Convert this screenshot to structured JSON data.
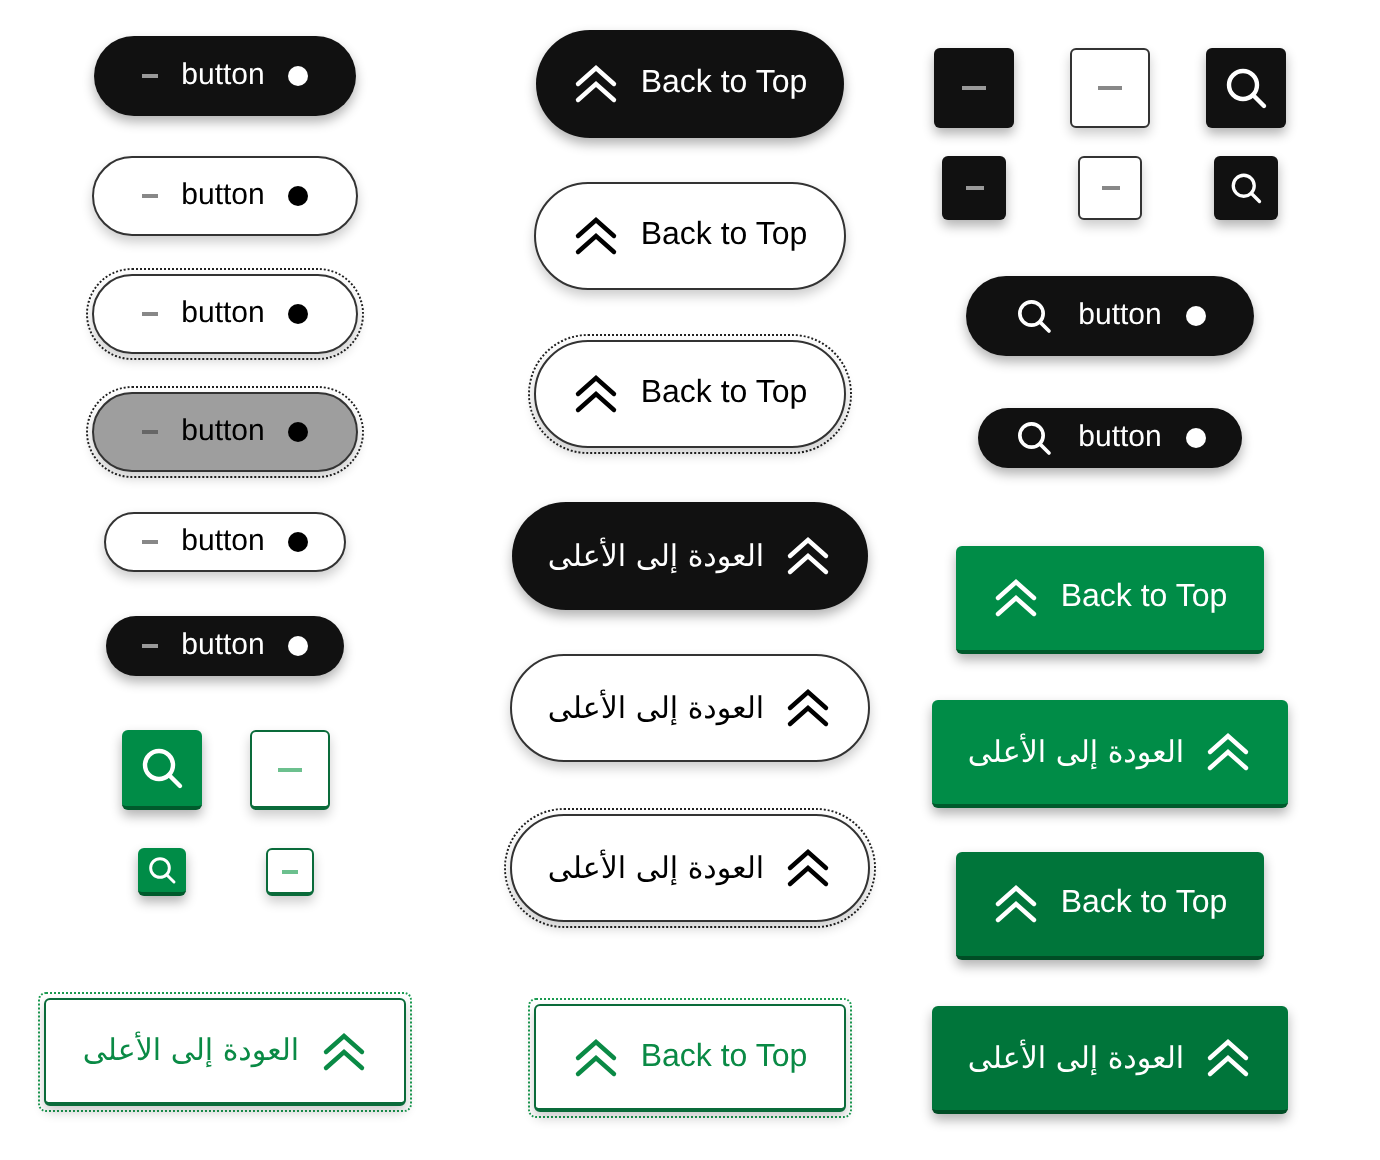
{
  "columns": [
    {
      "buttons": [
        {
          "label": "button",
          "focused": false
        },
        {
          "label": "button",
          "focused": false
        },
        {
          "label": "button",
          "focused": true
        },
        {
          "label": "button",
          "focused": true
        },
        {
          "label": "button",
          "focused": false
        },
        {
          "label": "button",
          "focused": false
        },
        {
          "label": "العودة إلى الأعلى",
          "focused": true
        }
      ]
    },
    {
      "buttons": [
        {
          "label": "Back to Top",
          "focused": false
        },
        {
          "label": "Back to Top",
          "focused": false
        },
        {
          "label": "Back to Top",
          "focused": true
        },
        {
          "label": "العودة إلى الأعلى",
          "focused": false
        },
        {
          "label": "العودة إلى الأعلى",
          "focused": false
        },
        {
          "label": "العودة إلى الأعلى",
          "focused": true
        },
        {
          "label": "Back to Top",
          "focused": true
        }
      ]
    },
    {
      "buttons": [
        {
          "label": "button",
          "focused": false
        },
        {
          "label": "button",
          "focused": false
        },
        {
          "label": "Back to Top",
          "focused": false
        },
        {
          "label": "العودة إلى الأعلى",
          "focused": false
        },
        {
          "label": "Back to Top",
          "focused": false
        },
        {
          "label": "العودة إلى الأعلى",
          "focused": false
        }
      ]
    }
  ]
}
